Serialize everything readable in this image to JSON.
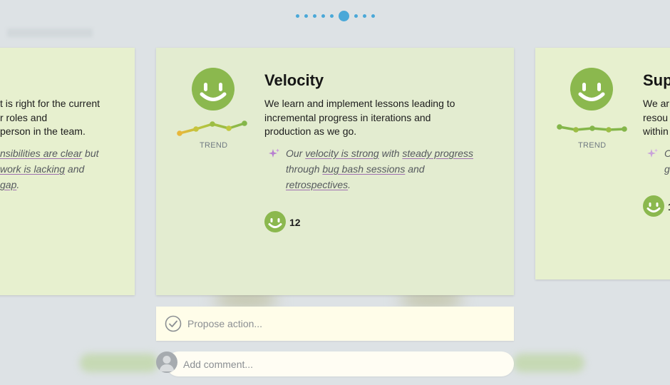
{
  "pager": {
    "total": 9,
    "active_index": 5,
    "color": "#4aa8d8"
  },
  "cards": {
    "left": {
      "description_lines": [
        "t is right for the current",
        "r roles and",
        "person in the team."
      ],
      "insight_lines": [
        [
          {
            "text": "nsibilities are clear",
            "u": true
          },
          {
            "text": " but",
            "u": false
          }
        ],
        [
          {
            "text": "work is lacking",
            "u": true
          },
          {
            "text": " and",
            "u": false
          }
        ],
        [
          {
            "text": " gap",
            "u": true
          },
          {
            "text": ".",
            "u": false
          }
        ]
      ]
    },
    "main": {
      "title": "Velocity",
      "face_icon": "smiley-face-icon",
      "trend_label": "TREND",
      "description_lines": [
        "We learn and implement lessons leading to",
        "incremental progress in iterations and",
        "production as we go."
      ],
      "insight_lines": [
        [
          {
            "text": "Our ",
            "u": false
          },
          {
            "text": "velocity is strong",
            "u": true
          },
          {
            "text": " with ",
            "u": false
          },
          {
            "text": "steady progress",
            "u": true
          }
        ],
        [
          {
            "text": "through ",
            "u": false
          },
          {
            "text": "bug bash sessions",
            "u": true
          },
          {
            "text": " and",
            "u": false
          }
        ],
        [
          {
            "text": "retrospectives",
            "u": true
          },
          {
            "text": ".",
            "u": false
          }
        ]
      ],
      "vote_count": "12"
    },
    "right": {
      "title": "Sup",
      "trend_label": "TREND",
      "description_lines": [
        "We ar",
        "resou",
        "within"
      ],
      "insight_lines": [
        [
          {
            "text": "C",
            "u": false
          }
        ],
        [
          {
            "text": "g",
            "u": false
          }
        ]
      ],
      "vote_count": "1"
    }
  },
  "actions": {
    "propose_placeholder": "Propose action...",
    "comment_placeholder": "Add comment..."
  },
  "colors": {
    "face": "#8bb84e",
    "card_bg": "#e3ecd0",
    "insight_underline": "#9f6fb0",
    "sparkle": "#b77fd0",
    "propose_bg": "#fffde9"
  }
}
